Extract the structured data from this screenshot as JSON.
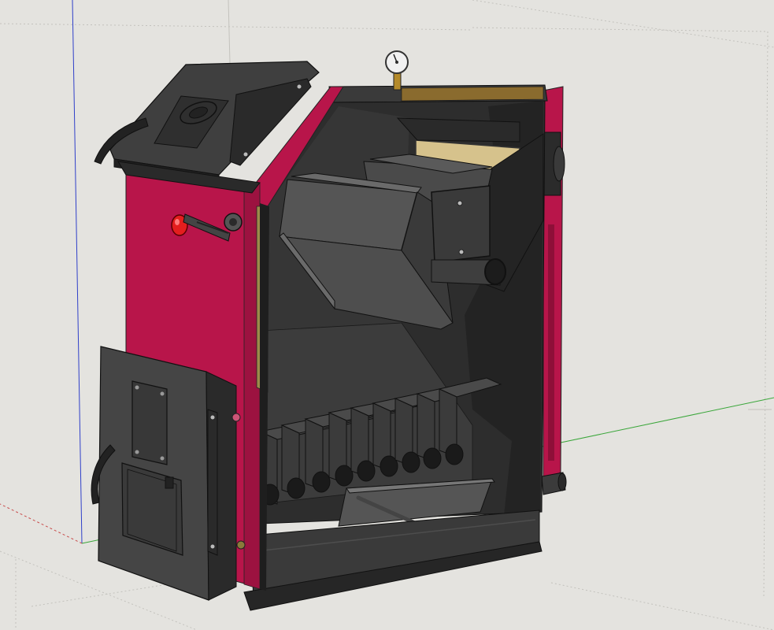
{
  "viewport": {
    "background": "#e4e3df",
    "axis_colors": {
      "blue_axis": "#2f3fc9",
      "green_axis": "#3aa63a",
      "red_axis": "#c84b4b"
    }
  },
  "boiler": {
    "body_color": "#b8154a",
    "body_shade_color": "#8e0f38",
    "metal_color": "#3b3b3b",
    "metal_dark_color": "#1c1c1c",
    "interior_color": "#2a2a2a",
    "insulation_color": "#c9b37a",
    "indicator_color": "#e41e1e",
    "grate_bar_count": 9,
    "components": [
      "pressure-gauge",
      "top-loading-door",
      "front-door",
      "ash-door",
      "heat-exchanger-baffle",
      "fire-grate",
      "ash-pan",
      "poker-rod",
      "thermostat-knob",
      "outlet-pipe",
      "base-plate"
    ]
  }
}
